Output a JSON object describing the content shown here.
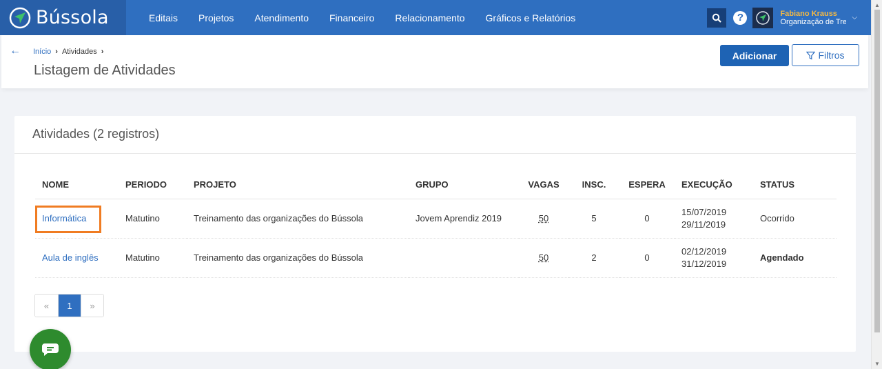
{
  "brand": {
    "name": "Bússola",
    "logo_icon": "compass-logo-icon"
  },
  "nav": {
    "items": [
      {
        "label": "Editais"
      },
      {
        "label": "Projetos"
      },
      {
        "label": "Atendimento"
      },
      {
        "label": "Financeiro"
      },
      {
        "label": "Relacionamento"
      },
      {
        "label": "Gráficos e Relatórios"
      }
    ]
  },
  "user": {
    "name": "Fabiano Krauss",
    "org": "Organização de Tre",
    "help_label": "?"
  },
  "breadcrumb": {
    "home": "Início",
    "separator": "›",
    "current": "Atividades",
    "separator2": "›"
  },
  "page": {
    "title": "Listagem de Atividades"
  },
  "actions": {
    "add_label": "Adicionar",
    "filter_label": "Filtros"
  },
  "card": {
    "title": "Atividades (2 registros)"
  },
  "table": {
    "headers": [
      "NOME",
      "PERIODO",
      "PROJETO",
      "GRUPO",
      "VAGAS",
      "INSC.",
      "ESPERA",
      "EXECUÇÃO",
      "STATUS"
    ],
    "rows": [
      {
        "nome": "Informática",
        "periodo": "Matutino",
        "projeto": "Treinamento das organizações do Bússola",
        "grupo": "Jovem Aprendiz 2019",
        "vagas": "50",
        "insc": "5",
        "espera": "0",
        "exec_start": "15/07/2019",
        "exec_end": "29/11/2019",
        "status": "Ocorrido"
      },
      {
        "nome": "Aula de inglês",
        "periodo": "Matutino",
        "projeto": "Treinamento das organizações do Bússola",
        "grupo": "",
        "vagas": "50",
        "insc": "2",
        "espera": "0",
        "exec_start": "02/12/2019",
        "exec_end": "31/12/2019",
        "status": "Agendado"
      }
    ]
  },
  "pagination": {
    "prev": "«",
    "current": "1",
    "next": "»"
  },
  "colors": {
    "primary": "#2f6fc0",
    "highlight": "#f07c22",
    "chat": "#2e8b2e",
    "user_name": "#f4b942"
  }
}
